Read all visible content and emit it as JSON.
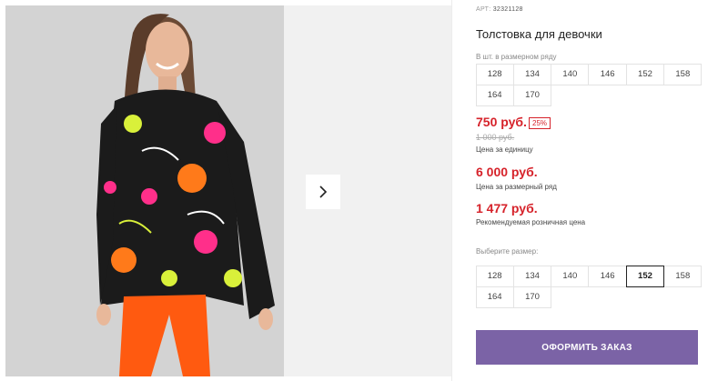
{
  "product": {
    "article_label": "АРТ:",
    "article": "32321128",
    "title": "Толстовка для девочки"
  },
  "sizes_in_row": {
    "label": "В шт. в размерном ряду",
    "sizes": [
      "128",
      "134",
      "140",
      "146",
      "152",
      "158",
      "164",
      "170"
    ]
  },
  "pricing": {
    "unit_price": "750 руб.",
    "discount": "25%",
    "old_price": "1 000 руб.",
    "unit_caption": "Цена за единицу",
    "row_price": "6 000 руб.",
    "row_caption": "Цена за размерный ряд",
    "retail_price": "1 477 руб.",
    "retail_caption": "Рекомендуемая розничная цена"
  },
  "size_select": {
    "label": "Выберите размер:",
    "sizes": [
      "128",
      "134",
      "140",
      "146",
      "152",
      "158",
      "164",
      "170"
    ],
    "selected": "152"
  },
  "order_button": "ОФОРМИТЬ ЗАКАЗ",
  "icons": {
    "next": "chevron-right-icon"
  },
  "colors": {
    "accent": "#7b63a6",
    "price": "#d6222a"
  }
}
